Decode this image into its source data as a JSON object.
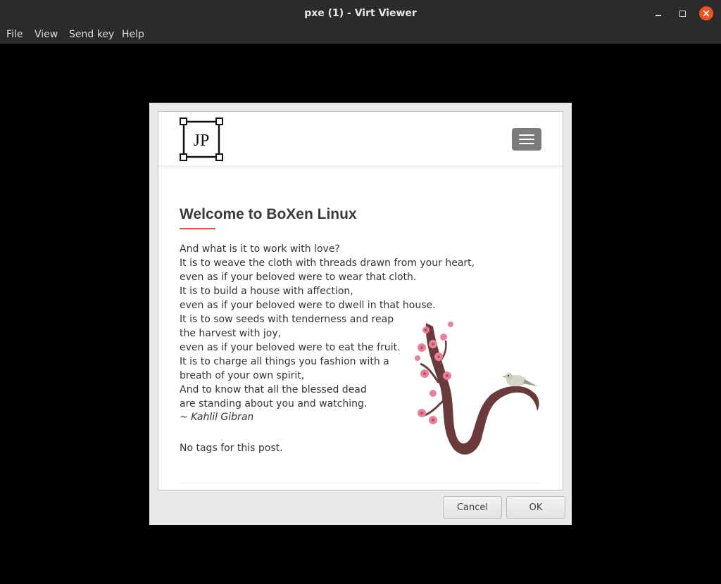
{
  "window": {
    "title": "pxe (1) - Virt Viewer",
    "accent_close": "#e95420"
  },
  "menu": {
    "items": [
      "File",
      "View",
      "Send key",
      "Help"
    ]
  },
  "page": {
    "logo_text": "JP",
    "title": "Welcome to BoXen Linux",
    "accent": "#d35e3b",
    "poem": [
      "And what is it to work with love?",
      "It is to weave the cloth with threads drawn from your heart,",
      "even as if your beloved were to wear that cloth.",
      "It is to build a house with affection,",
      "even as if your beloved were to dwell in that house.",
      "It is to sow seeds with tenderness and reap",
      "the harvest with joy,",
      "even as if your beloved were to eat the fruit.",
      "It is to charge all things you fashion with a",
      "breath of your own spirit,",
      "And to know that all the blessed dead",
      "are standing about you and watching."
    ],
    "author": "~ Kahlil Gibran",
    "tags": "No tags for this post."
  },
  "dialog": {
    "cancel_label": "Cancel",
    "ok_label": "OK"
  },
  "icons": {
    "minimize": "minimize-icon",
    "maximize": "maximize-icon",
    "close": "close-icon",
    "menu": "hamburger-icon",
    "illustration": "cherry-blossom-branch-with-bird"
  }
}
